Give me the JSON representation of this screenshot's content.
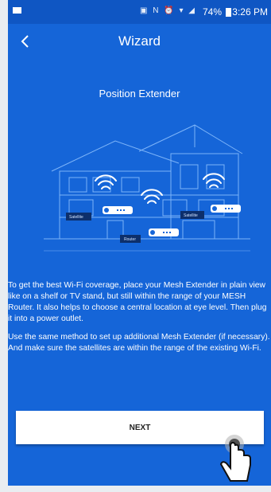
{
  "status_bar": {
    "icons": "▣ N ⏰ ▾ ◢",
    "battery_percent": "74%",
    "time": "3:26 PM"
  },
  "app_bar": {
    "title": "Wizard",
    "back_icon": "chevron-left-icon"
  },
  "illustration": {
    "title": "Position Extender",
    "labels": {
      "satellite_left": "Satellite",
      "satellite_right": "Satellite",
      "router": "Router"
    }
  },
  "description": {
    "paragraph_1": "To get the best Wi-Fi coverage, place your Mesh Extender in plain view like on a shelf or TV stand, but still within the range of your MESH Router. It also helps to choose a central location at eye level. Then plug it into a power outlet.",
    "paragraph_2": "Use the same method to set up additional Mesh Extender (if necessary). And make sure the satellites are within the range of the existing Wi-Fi."
  },
  "actions": {
    "next_label": "NEXT"
  },
  "colors": {
    "background": "#1565d8",
    "status_bar": "#0f56c3",
    "button": "#ffffff"
  }
}
